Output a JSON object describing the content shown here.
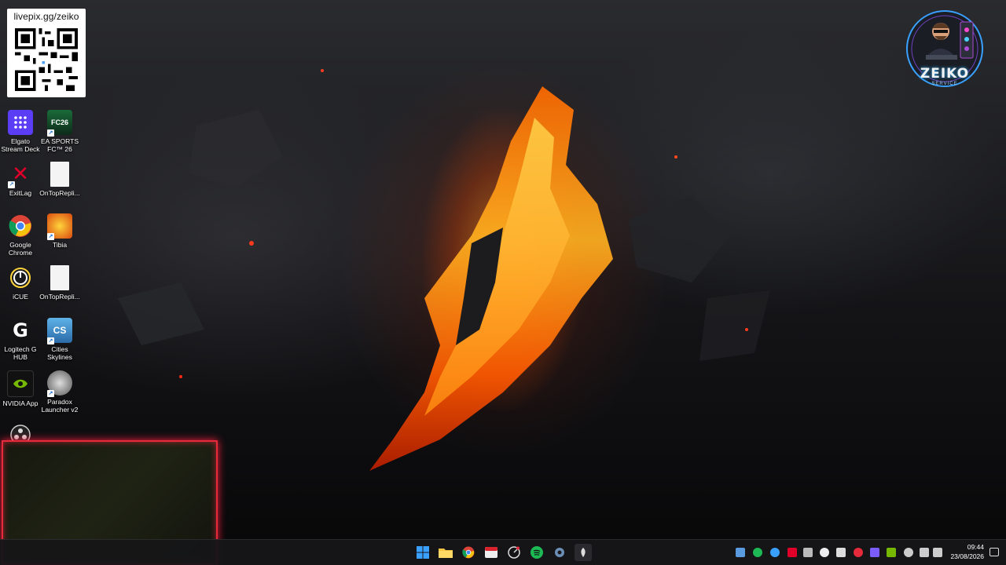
{
  "qr_badge": {
    "url": "livepix.gg/zeiko"
  },
  "brand": {
    "name": "ZEIKO",
    "tagline": "SERVICE"
  },
  "desktop_icons": [
    {
      "label": "Elgato Stream Deck",
      "icon": "elgato-stream-deck-icon"
    },
    {
      "label": "EA SPORTS FC™ 26",
      "icon": "ea-fc-26-icon"
    },
    {
      "label": "ExitLag",
      "icon": "exitlag-icon"
    },
    {
      "label": "OnTopRepli...",
      "icon": "file-icon"
    },
    {
      "label": "Google Chrome",
      "icon": "chrome-icon"
    },
    {
      "label": "Tibia",
      "icon": "tibia-icon"
    },
    {
      "label": "iCUE",
      "icon": "icue-icon"
    },
    {
      "label": "OnTopRepli...",
      "icon": "file-icon"
    },
    {
      "label": "Logitech G HUB",
      "icon": "logitech-g-hub-icon"
    },
    {
      "label": "Cities Skylines",
      "icon": "cities-skylines-icon"
    },
    {
      "label": "NVIDIA App",
      "icon": "nvidia-icon"
    },
    {
      "label": "Paradox Launcher v2",
      "icon": "paradox-launcher-icon"
    }
  ],
  "taskbar": {
    "apps": [
      "windows-start-icon",
      "file-explorer-icon",
      "chrome-icon",
      "calendar-app-icon",
      "speedometer-icon",
      "spotify-icon",
      "settings-icon",
      "steam-like-icon"
    ],
    "clock": {
      "time": "09:44",
      "date": "23/08/2026"
    }
  },
  "colors": {
    "webcam_border": "#e52a3c",
    "taskbar_bg": "#161618"
  }
}
